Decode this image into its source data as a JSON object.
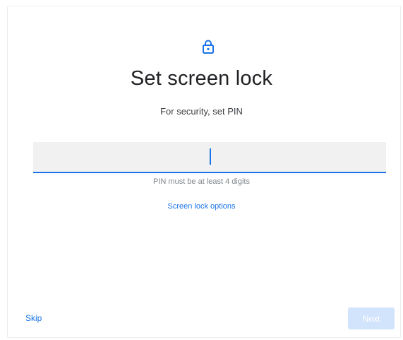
{
  "header": {
    "icon": "lock-icon",
    "title": "Set screen lock",
    "subtitle": "For security, set PIN"
  },
  "pin_input": {
    "value": "",
    "hint": "PIN must be at least 4 digits"
  },
  "links": {
    "screen_lock_options": "Screen lock options"
  },
  "footer": {
    "skip_label": "Skip",
    "next_label": "Next",
    "next_enabled": false
  },
  "colors": {
    "accent": "#1a73e8",
    "field_bg": "#f1f1f1",
    "disabled_button": "#d2e3fc"
  }
}
